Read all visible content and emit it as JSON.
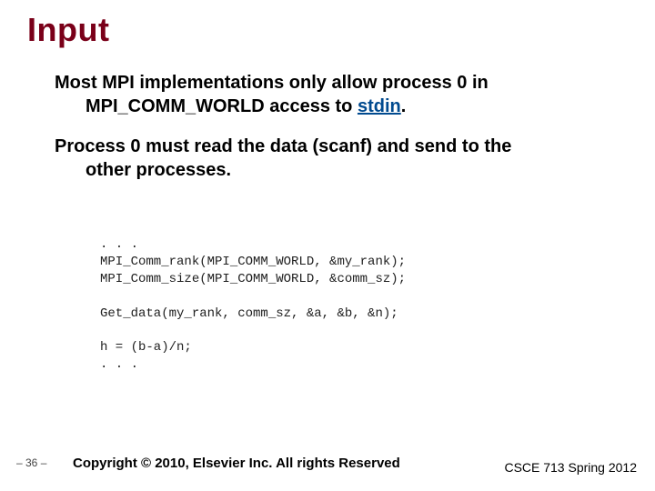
{
  "title": "Input",
  "bullets": {
    "b1": {
      "line1": "Most MPI implementations only allow process 0 in",
      "line2_pre": "MPI_COMM_WORLD access to ",
      "stdin": "stdin",
      "line2_post": "."
    },
    "b2": {
      "line1": "Process 0 must read the data (scanf) and send to the",
      "line2": "other processes."
    }
  },
  "code": {
    "l1": ". . .",
    "l2": "MPI_Comm_rank(MPI_COMM_WORLD, &my_rank);",
    "l3": "MPI_Comm_size(MPI_COMM_WORLD, &comm_sz);",
    "l4": "",
    "l5": "Get_data(my_rank, comm_sz, &a, &b, &n);",
    "l6": "",
    "l7": "h = (b-a)/n;",
    "l8": ". . ."
  },
  "footer": {
    "page": "– 36 –",
    "copyright": "Copyright © 2010, Elsevier Inc. All rights Reserved",
    "course": "CSCE 713 Spring 2012"
  }
}
